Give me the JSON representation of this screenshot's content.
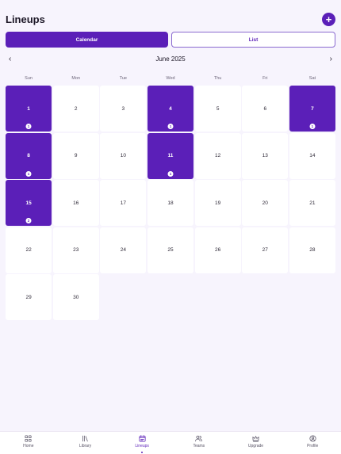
{
  "header": {
    "title": "Lineups",
    "add_label": "+"
  },
  "view_toggle": {
    "options": [
      "Calendar",
      "List"
    ],
    "selected": "Calendar"
  },
  "calendar": {
    "month_label": "June 2025",
    "prev_label": "‹",
    "next_label": "›",
    "weekdays": [
      "Sun",
      "Mon",
      "Tue",
      "Wed",
      "Thu",
      "Fri",
      "Sat"
    ],
    "leading_blank_days": 0,
    "days": [
      {
        "day": "1",
        "count": "1"
      },
      {
        "day": "2"
      },
      {
        "day": "3"
      },
      {
        "day": "4",
        "count": "1"
      },
      {
        "day": "5"
      },
      {
        "day": "6"
      },
      {
        "day": "7",
        "count": "1"
      },
      {
        "day": "8",
        "count": "1"
      },
      {
        "day": "9"
      },
      {
        "day": "10"
      },
      {
        "day": "11",
        "count": "1"
      },
      {
        "day": "12"
      },
      {
        "day": "13"
      },
      {
        "day": "14"
      },
      {
        "day": "15",
        "count": "2"
      },
      {
        "day": "16"
      },
      {
        "day": "17"
      },
      {
        "day": "18"
      },
      {
        "day": "19"
      },
      {
        "day": "20"
      },
      {
        "day": "21"
      },
      {
        "day": "22"
      },
      {
        "day": "23"
      },
      {
        "day": "24"
      },
      {
        "day": "25"
      },
      {
        "day": "26"
      },
      {
        "day": "27"
      },
      {
        "day": "28"
      },
      {
        "day": "29"
      },
      {
        "day": "30"
      }
    ]
  },
  "tabbar": {
    "items": [
      {
        "label": "Home",
        "icon": "home-grid-icon"
      },
      {
        "label": "Library",
        "icon": "library-icon"
      },
      {
        "label": "Lineups",
        "icon": "calendar-icon"
      },
      {
        "label": "Teams",
        "icon": "users-icon"
      },
      {
        "label": "Upgrade",
        "icon": "crown-icon"
      },
      {
        "label": "Profile",
        "icon": "profile-icon"
      }
    ],
    "active": "Lineups"
  },
  "colors": {
    "accent": "#5b1fb8",
    "background": "#f7f4fd"
  }
}
